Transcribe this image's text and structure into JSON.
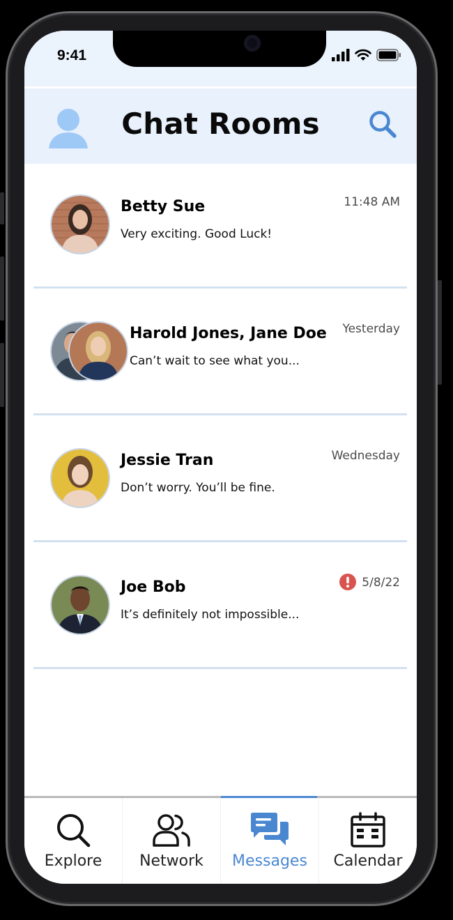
{
  "status_bar": {
    "time": "9:41"
  },
  "header": {
    "title": "Chat Rooms"
  },
  "chats": [
    {
      "name": "Betty Sue",
      "preview": "Very exciting. Good Luck!",
      "time": "11:48 AM",
      "alert": false
    },
    {
      "name": "Harold Jones, Jane Doe",
      "preview": "Can’t wait to see what you...",
      "time": "Yesterday",
      "alert": false
    },
    {
      "name": "Jessie Tran",
      "preview": "Don’t worry. You’ll be fine.",
      "time": "Wednesday",
      "alert": false
    },
    {
      "name": "Joe Bob",
      "preview": "It’s definitely not impossible...",
      "time": "5/8/22",
      "alert": true
    }
  ],
  "tabs": [
    {
      "label": "Explore",
      "icon": "search-icon",
      "active": false
    },
    {
      "label": "Network",
      "icon": "people-icon",
      "active": false
    },
    {
      "label": "Messages",
      "icon": "chat-bubbles-icon",
      "active": true
    },
    {
      "label": "Calendar",
      "icon": "calendar-icon",
      "active": false
    }
  ],
  "colors": {
    "accent": "#4a87d1",
    "header_bg": "#e8f1fc",
    "divider": "#d2e1f0",
    "alert": "#d9534f"
  }
}
